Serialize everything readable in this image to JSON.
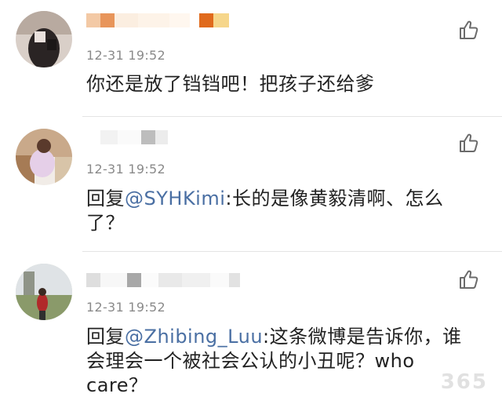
{
  "comments": [
    {
      "timestamp": "12-31 19:52",
      "text": "你还是放了铛铛吧！把孩子还给爹",
      "mention": "",
      "reply_prefix": ""
    },
    {
      "timestamp": "12-31 19:52",
      "reply_prefix": "回复",
      "mention": "@SYHKimi",
      "text": ":长的是像黄毅清啊、怎么了？"
    },
    {
      "timestamp": "12-31 19:52",
      "reply_prefix": "回复",
      "mention": "@Zhibing_Luu",
      "text": ":这条微博是告诉你，谁会理会一个被社会公认的小丑呢？who care？"
    }
  ],
  "watermark": "365",
  "colors": {
    "mention": "#4a6fa3",
    "timestamp": "#8a8a8a",
    "divider": "#e4e4e4"
  },
  "icons": {
    "like": "thumbs-up-icon"
  }
}
